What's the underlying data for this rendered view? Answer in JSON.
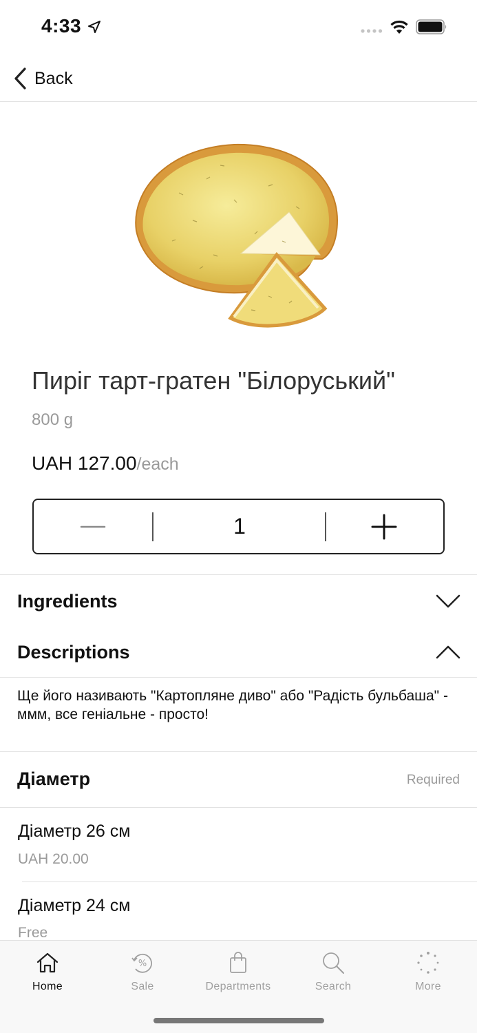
{
  "status_bar": {
    "time": "4:33"
  },
  "nav": {
    "back_label": "Back"
  },
  "product": {
    "title": "Пиріг тарт-гратен \"Білоруський\"",
    "weight": "800 g",
    "price": "UAH 127.00",
    "price_unit": "/each",
    "quantity": "1"
  },
  "sections": {
    "ingredients": "Ingredients",
    "descriptions": "Descriptions",
    "description_text": "Ще його називають \"Картопляне диво\" або \"Радість бульбаша\" - ммм, все геніальне - просто!"
  },
  "options": {
    "group_title": "Діаметр",
    "required_label": "Required",
    "items": [
      {
        "name": "Діаметр 26 см",
        "price": "UAH 20.00"
      },
      {
        "name": "Діаметр 24 см",
        "price": "Free"
      }
    ]
  },
  "tab_bar": {
    "items": [
      {
        "label": "Home",
        "icon": "home-icon"
      },
      {
        "label": "Sale",
        "icon": "sale-icon"
      },
      {
        "label": "Departments",
        "icon": "bag-icon"
      },
      {
        "label": "Search",
        "icon": "search-icon"
      },
      {
        "label": "More",
        "icon": "more-icon"
      }
    ]
  },
  "colors": {
    "accent": "#111111",
    "muted": "#9a9a9a",
    "border": "#e2e2e2"
  }
}
